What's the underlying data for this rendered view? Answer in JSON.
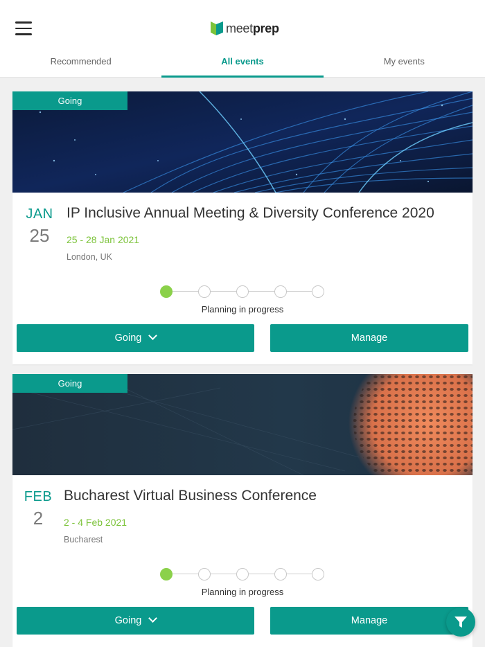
{
  "app": {
    "logo_meet": "meet",
    "logo_prep": "prep",
    "accent_color": "#0a9a8c",
    "date_color": "#7cc33a"
  },
  "tabs": [
    {
      "label": "Recommended",
      "active": false
    },
    {
      "label": "All events",
      "active": true
    },
    {
      "label": "My events",
      "active": false
    }
  ],
  "events": [
    {
      "tag": "Going",
      "month": "JAN",
      "day": "25",
      "title": "IP Inclusive Annual Meeting & Diversity Conference 2020",
      "dates": "25 - 28 Jan 2021",
      "location": "London, UK",
      "status": "Planning in progress",
      "progress_steps_total": 5,
      "progress_steps_done": 1,
      "going_label": "Going",
      "manage_label": "Manage",
      "banner_icon": "fiber-optic-banner"
    },
    {
      "tag": "Going",
      "month": "FEB",
      "day": "2",
      "title": "Bucharest Virtual Business Conference",
      "dates": "2 - 4 Feb 2021",
      "location": "Bucharest",
      "status": "Planning in progress",
      "progress_steps_total": 5,
      "progress_steps_done": 1,
      "going_label": "Going",
      "manage_label": "Manage",
      "banner_icon": "abstract-texture-banner"
    }
  ],
  "fab": {
    "icon": "filter-icon"
  }
}
